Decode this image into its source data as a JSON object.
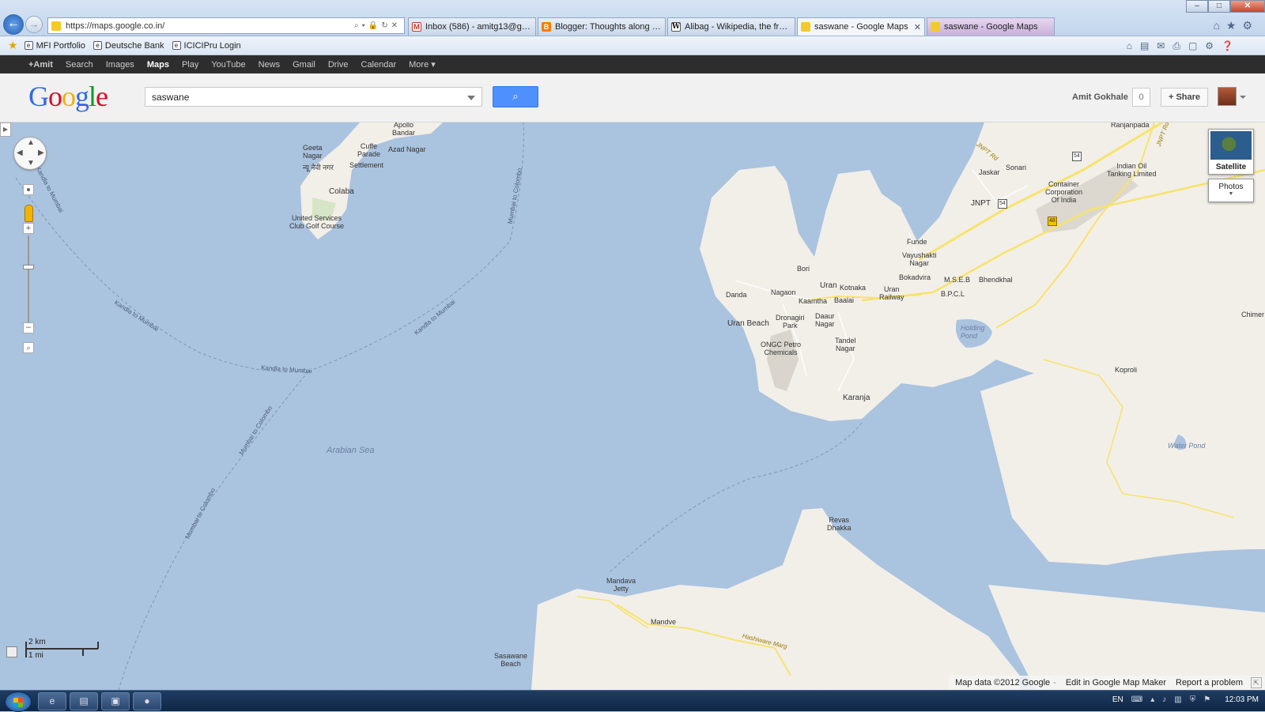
{
  "browser": {
    "address": "https://maps.google.co.in/",
    "tabs": [
      {
        "label": "Inbox (586) - amitg13@gmail.c...",
        "icon": "gmail-icon"
      },
      {
        "label": "Blogger: Thoughts along the w...",
        "icon": "blogger-icon"
      },
      {
        "label": "Alibag - Wikipedia, the free en...",
        "icon": "wikipedia-icon"
      },
      {
        "label": "saswane - Google Maps",
        "icon": "maps-icon",
        "active": true
      },
      {
        "label": "saswane - Google Maps",
        "icon": "maps-icon"
      }
    ],
    "favorites": [
      "MFI Portfolio",
      "Deutsche Bank",
      "ICICIPru Login"
    ]
  },
  "gbar": {
    "items": [
      "+Amit",
      "Search",
      "Images",
      "Maps",
      "Play",
      "YouTube",
      "News",
      "Gmail",
      "Drive",
      "Calendar",
      "More ▾"
    ],
    "active": "Maps"
  },
  "header": {
    "logo": [
      "G",
      "o",
      "o",
      "g",
      "l",
      "e"
    ],
    "logo_colors": [
      "#3369e8",
      "#d50f25",
      "#eeb211",
      "#3369e8",
      "#009925",
      "#d50f25"
    ],
    "search_value": "saswane",
    "user_name": "Amit Gokhale",
    "notification_count": "0",
    "share_label": "+ Share"
  },
  "map": {
    "labels": {
      "apollo_bandar": "Apollo\nBandar",
      "geeta_nagar": "Geeta\nNagar",
      "cuffe_parade": "Cuffe\nParade",
      "azad_nagar": "Azad Nagar",
      "navy_nagar": "न्यू नेवी नगर",
      "settlement": "Settlement",
      "colaba": "Colaba",
      "usc_golf": "United Services\nClub Golf Course",
      "arabian_sea": "Arabian Sea",
      "route1": "Kandla to Mumbai",
      "route2": "Kandla to Mumbai",
      "route3": "Kandla to Mumbai",
      "route4": "Kandla to Mumbai",
      "route5": "Mumbai to Colombo",
      "route6": "Mumbai to Colombo",
      "ranjanpada": "Ranjanpada",
      "jnpt_rd": "JNPT Rd",
      "jnpt_rd2": "JNPT Rd",
      "sonari": "Sonari",
      "jaskar": "Jaskar",
      "indian_oil": "Indian Oil\nTanking Limited",
      "container_corp": "Container\nCorporation\nOf India",
      "jnpt": "JNPT",
      "funde": "Funde",
      "vayushakti": "Vayushakti\nNagar",
      "bori": "Bori",
      "bokadvira": "Bokadvira",
      "mseb": "M.S.E.B",
      "bhendkhal": "Bhendkhal",
      "danda": "Danda",
      "nagaon": "Nagaon",
      "uran": "Uran",
      "kotnaka": "Kotnaka",
      "uran_railway": "Uran\nRailway",
      "bpcl": "B.P.C.L",
      "kaamtha": "Kaamtha",
      "baalai": "Baalai",
      "uran_beach": "Uran Beach",
      "dronagiri": "Dronagiri\nPark",
      "daaur_nagar": "Daaur\nNagar",
      "holding_pond": "Holding\nPond",
      "chimer": "Chimer",
      "ongc": "ONGC Petro\nChemicals",
      "tandel_nagar": "Tandel\nNagar",
      "koproli": "Koproli",
      "karanja": "Karanja",
      "water_pond": "Water Pond",
      "revas_dhakka": "Revas\nDhakka",
      "mandava_jetty": "Mandava\nJetty",
      "mandve": "Mandve",
      "hashiware_marg": "Hashiware Marg",
      "sasawane_beach": "Sasawane\nBeach",
      "shield_54a": "54",
      "shield_54b": "54",
      "shield_48": "48"
    },
    "scale": {
      "km": "2 km",
      "mi": "1 mi"
    },
    "satellite_label": "Satellite",
    "photos_label": "Photos",
    "attribution": {
      "data": "Map data ©2012 Google",
      "sep": "-",
      "edit": "Edit in Google Map Maker",
      "report": "Report a problem"
    }
  },
  "taskbar": {
    "lang": "EN",
    "clock": "12:03 PM"
  }
}
